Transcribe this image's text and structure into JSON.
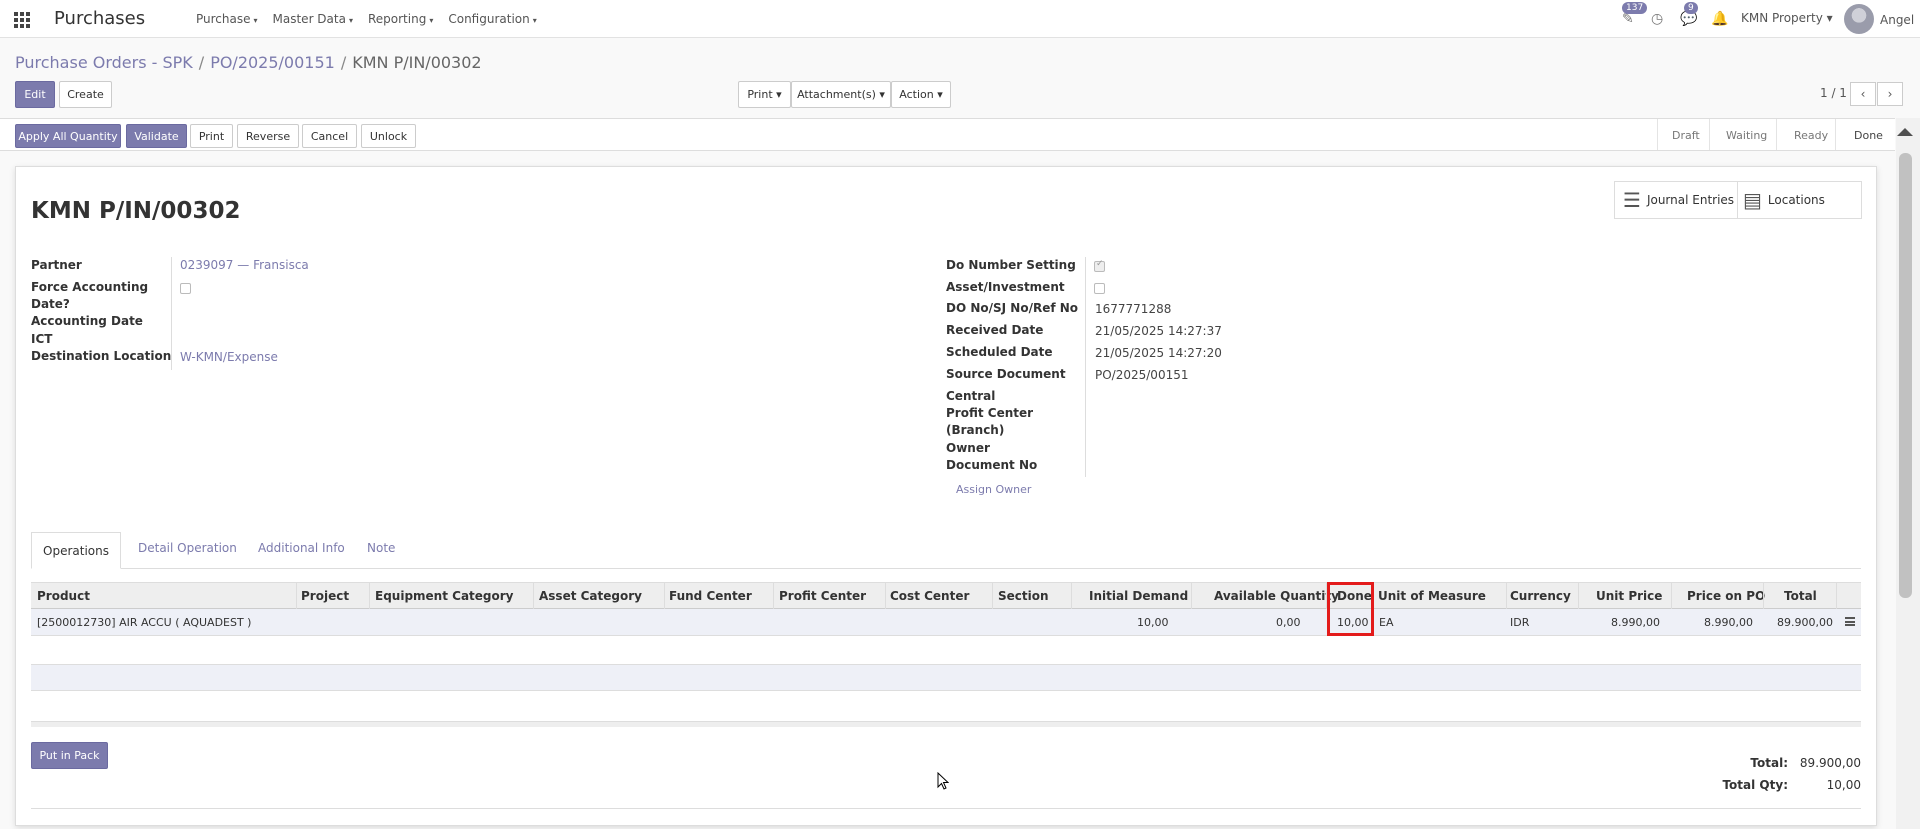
{
  "navbar": {
    "brand": "Purchases",
    "menu": [
      "Purchase",
      "Master Data",
      "Reporting",
      "Configuration"
    ],
    "activity_badge": "137",
    "messages_badge": "9",
    "company": "KMN Property",
    "user": "Angel"
  },
  "breadcrumb": {
    "items": [
      "Purchase Orders - SPK",
      "PO/2025/00151"
    ],
    "current": "KMN P/IN/00302"
  },
  "control": {
    "edit": "Edit",
    "create": "Create",
    "print": "Print",
    "attachments": "Attachment(s)",
    "action": "Action",
    "pager": "1 / 1"
  },
  "statusbar": {
    "buttons": [
      "Apply All Quantity",
      "Validate",
      "Print",
      "Reverse",
      "Cancel",
      "Unlock"
    ],
    "stages": [
      "Draft",
      "Waiting",
      "Ready",
      "Done"
    ]
  },
  "smart_buttons": {
    "journal_entries": "Journal Entries",
    "locations": "Locations"
  },
  "record": {
    "title": "KMN P/IN/00302",
    "left_fields": {
      "partner_label": "Partner",
      "partner_value": "0239097 — Fransisca",
      "force_label_1": "Force Accounting",
      "force_label_2": "Date?",
      "acc_date_label": "Accounting Date",
      "ict_label": "ICT",
      "dest_label": "Destination Location",
      "dest_value": "W-KMN/Expense"
    },
    "right_fields": {
      "do_setting_label": "Do Number Setting",
      "asset_label": "Asset/Investment",
      "do_no_label": "DO No/SJ No/Ref No",
      "do_no_value": "1677771288",
      "received_label": "Received Date",
      "received_value": "21/05/2025 14:27:37",
      "scheduled_label": "Scheduled Date",
      "scheduled_value": "21/05/2025 14:27:20",
      "source_label": "Source Document",
      "source_value": "PO/2025/00151",
      "central_label": "Central",
      "profit_label_1": "Profit Center",
      "profit_label_2": "(Branch)",
      "owner_label": "Owner",
      "docno_label": "Document No",
      "assign_owner": "Assign Owner"
    }
  },
  "tabs": [
    "Operations",
    "Detail Operation",
    "Additional Info",
    "Note"
  ],
  "table": {
    "headers": [
      "Product",
      "Project",
      "Equipment Category",
      "Asset Category",
      "Fund Center",
      "Profit Center",
      "Cost Center",
      "Section",
      "Initial Demand",
      "Available Quantity",
      "Done",
      "Unit of Measure",
      "Currency",
      "Unit Price",
      "Price on PO",
      "Total"
    ],
    "rows": [
      {
        "product": "[2500012730] AIR ACCU ( AQUADEST )",
        "initial_demand": "10,00",
        "available_quantity": "0,00",
        "done": "10,00",
        "uom": "EA",
        "currency": "IDR",
        "unit_price": "8.990,00",
        "price_on_po": "8.990,00",
        "total": "89.900,00"
      }
    ]
  },
  "footer": {
    "put_in_pack": "Put in Pack",
    "total_label": "Total:",
    "total_value": "89.900,00",
    "total_qty_label": "Total Qty:",
    "total_qty_value": "10,00"
  }
}
